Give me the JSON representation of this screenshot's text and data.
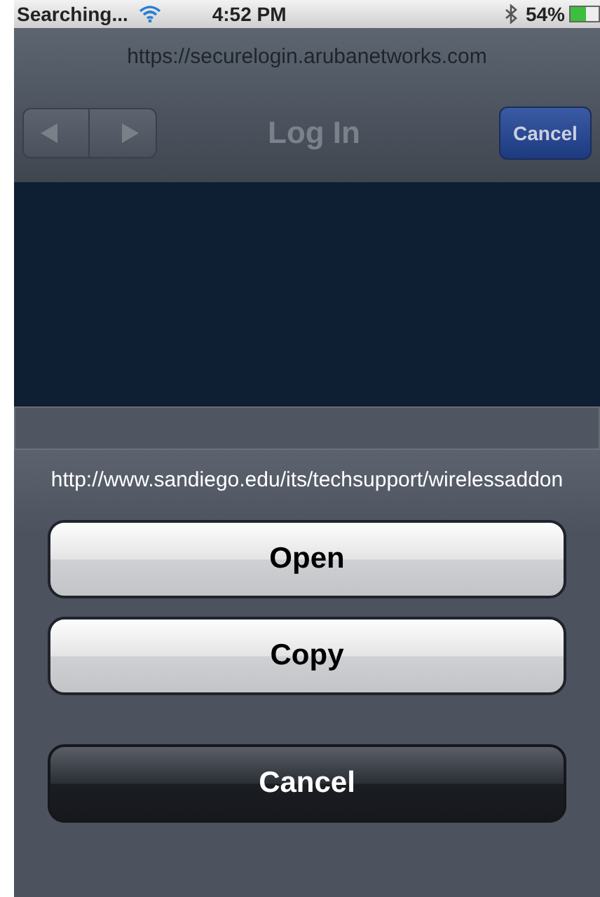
{
  "status_bar": {
    "carrier": "Searching...",
    "time": "4:52 PM",
    "battery": "54%"
  },
  "browser": {
    "url": "https://securelogin.arubanetworks.com",
    "title": "Log In",
    "cancel": "Cancel"
  },
  "action_sheet": {
    "link": "http://www.sandiego.edu/its/techsupport/wirelessaddon",
    "buttons": [
      {
        "label": "Open",
        "kind": "light"
      },
      {
        "label": "Copy",
        "kind": "light"
      },
      {
        "label": "Cancel",
        "kind": "dark"
      }
    ]
  }
}
